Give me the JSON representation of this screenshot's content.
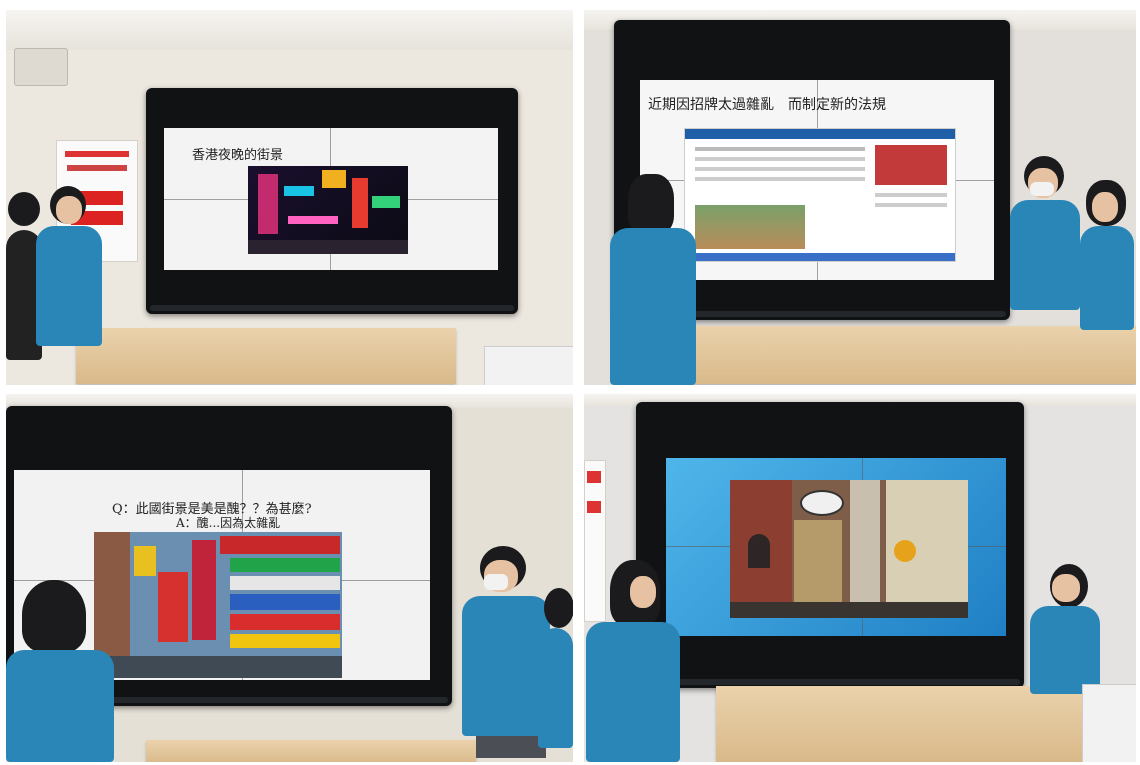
{
  "slides": {
    "p1_title": "香港夜晚的街景",
    "p2_title": "近期因招牌太過雜亂　而制定新的法規",
    "p3_question": "Q：此國街景是美是醜？？為甚麼?",
    "p3_answer": "A：醜...因為太雜亂"
  },
  "colors": {
    "uniform": "#2a86b6",
    "desk": "#e2c497",
    "tv_frame": "#101214",
    "slide_blue": "#3fa9e0"
  }
}
